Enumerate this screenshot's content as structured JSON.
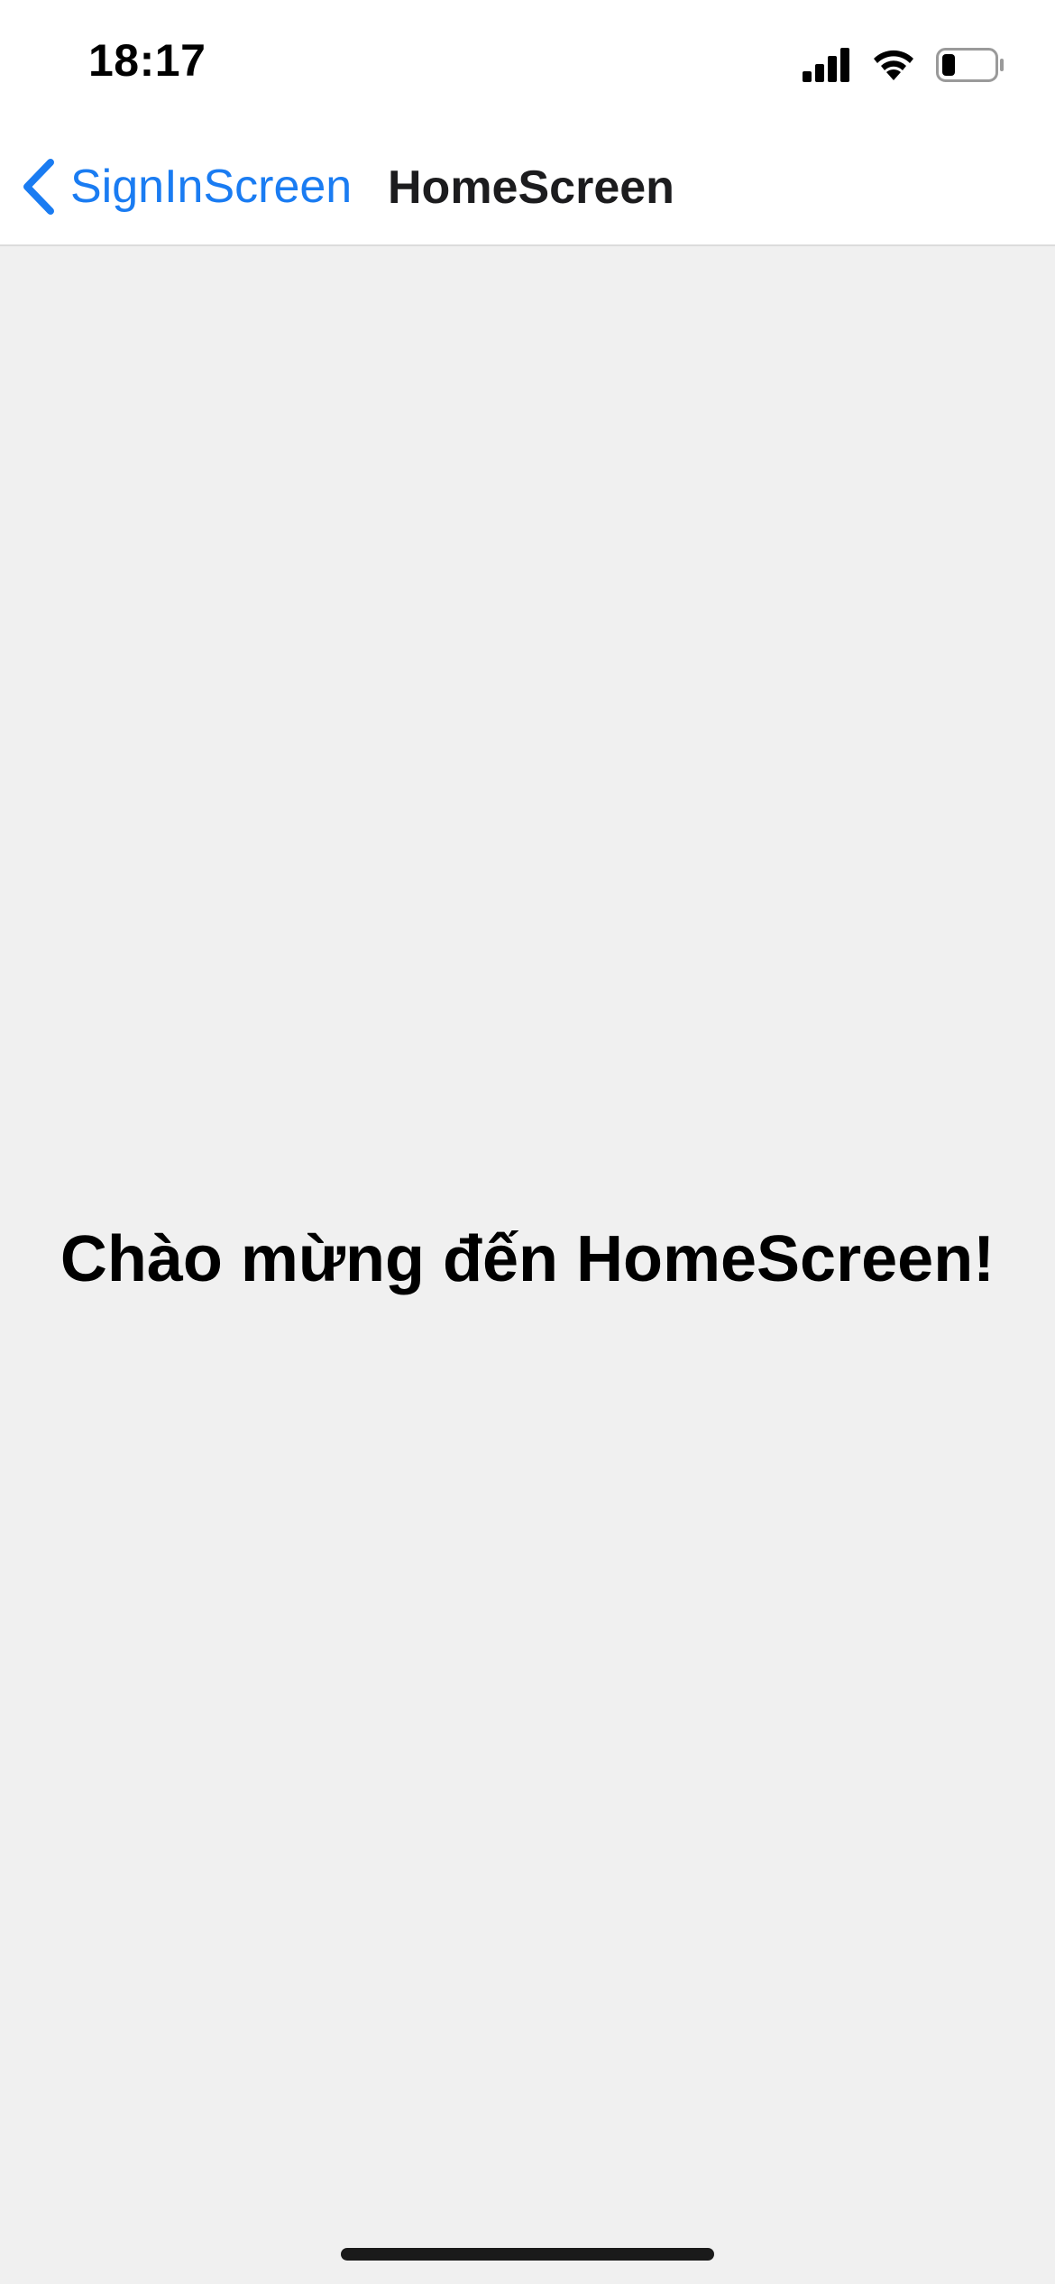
{
  "status_bar": {
    "time": "18:17",
    "icons": [
      "signal-icon",
      "wifi-icon",
      "battery-icon"
    ],
    "battery_level": 0.25
  },
  "nav": {
    "back_label": "SignInScreen",
    "back_icon": "chevron-left-icon",
    "title": "HomeScreen",
    "accent_color": "#1a7cf2"
  },
  "main": {
    "welcome_text": "Chào mừng đến HomeScreen!",
    "background_color": "#f0f0f0"
  }
}
